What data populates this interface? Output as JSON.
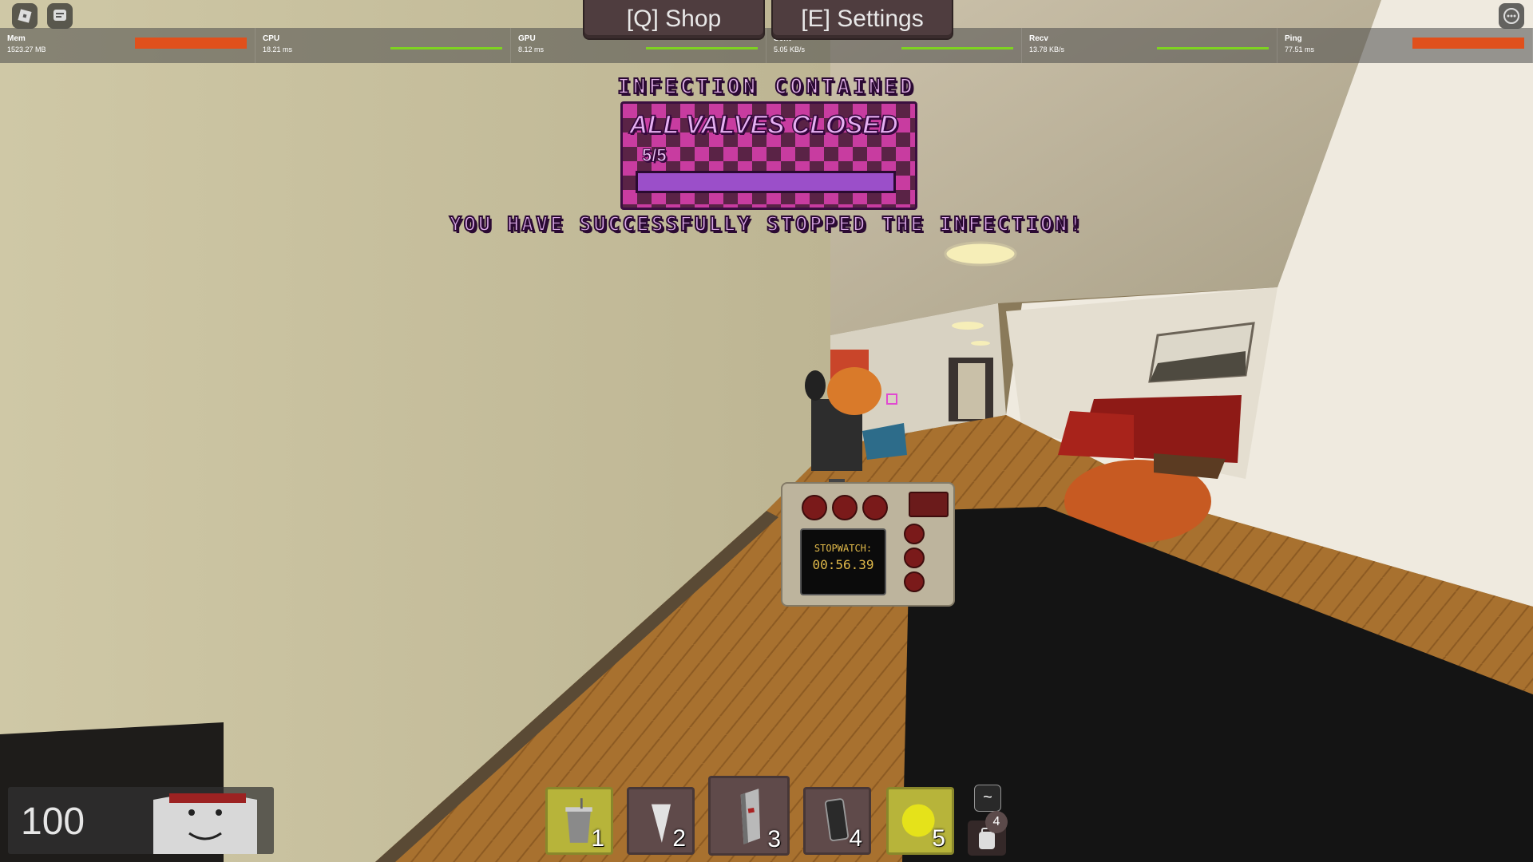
{
  "top_tabs": {
    "shop": "[Q] Shop",
    "settings": "[E] Settings"
  },
  "stats": [
    {
      "label": "Mem",
      "value": "1523.27 MB",
      "graph_color": "#e0501c",
      "style": "solid"
    },
    {
      "label": "CPU",
      "value": "18.21 ms",
      "graph_color": "#7ed321",
      "style": "line"
    },
    {
      "label": "GPU",
      "value": "8.12 ms",
      "graph_color": "#7ed321",
      "style": "line"
    },
    {
      "label": "Sent",
      "value": "5.05 KB/s",
      "graph_color": "#7ed321",
      "style": "line"
    },
    {
      "label": "Recv",
      "value": "13.78 KB/s",
      "graph_color": "#7ed321",
      "style": "line"
    },
    {
      "label": "Ping",
      "value": "77.51 ms",
      "graph_color": "#e0501c",
      "style": "solid"
    }
  ],
  "banner": {
    "title": "INFECTION CONTAINED",
    "panel_title": "ALL VALVES CLOSED",
    "count": "5/5",
    "progress": 1.0,
    "subtitle": "YOU HAVE SUCCESSFULLY STOPPED THE INFECTION!"
  },
  "stopwatch": {
    "label": "STOPWATCH:",
    "time": "00:56.39"
  },
  "health": {
    "value": "100"
  },
  "hotbar": {
    "slots": [
      {
        "number": "1",
        "item": "cup-icon",
        "bg": "#b7b43a"
      },
      {
        "number": "2",
        "item": "cone-icon",
        "bg": "#5f4a4a"
      },
      {
        "number": "3",
        "item": "can-icon",
        "bg": "#5f4a4a"
      },
      {
        "number": "4",
        "item": "phone-icon",
        "bg": "#5f4a4a"
      },
      {
        "number": "5",
        "item": "yellow-ball-icon",
        "bg": "#b7b43a"
      }
    ],
    "backpack_key": "~",
    "backpack_count": "4"
  },
  "colors": {
    "accent_purple": "#9b4fc9",
    "banner_pink": "#c83ca0"
  }
}
